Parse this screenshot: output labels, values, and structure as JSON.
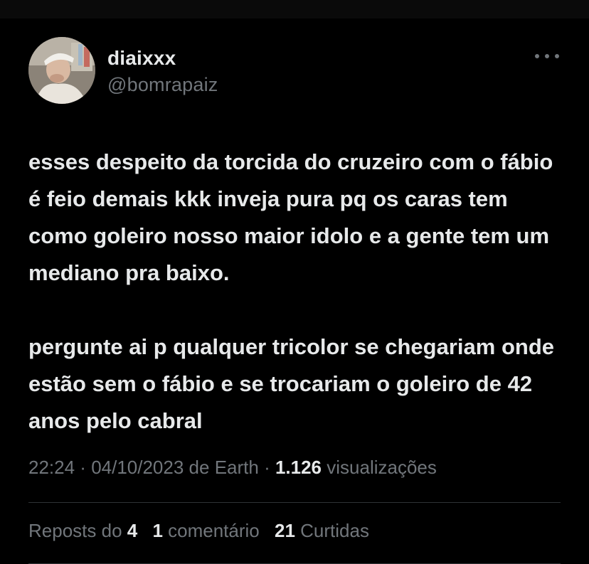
{
  "author": {
    "display_name": "diaixxx",
    "handle": "@bomrapaiz"
  },
  "tweet": {
    "paragraphs": [
      "esses despeito da torcida do cruzeiro com o fábio é feio demais kkk inveja pura pq os caras tem como goleiro nosso maior idolo e a gente tem um mediano pra baixo.",
      "pergunte ai p qualquer tricolor se chegariam onde estão sem o fábio e se trocariam o goleiro de 42 anos pelo cabral"
    ]
  },
  "meta": {
    "time": "22:24",
    "separator": " · ",
    "date": "04/10/2023",
    "source": " de Earth",
    "views_count": "1.126",
    "views_label": " visualizações"
  },
  "stats": {
    "reposts_label": "Reposts do ",
    "reposts_count": "4",
    "comments_count": "1",
    "comments_label": " comentário",
    "likes_count": "21",
    "likes_label": " Curtidas"
  },
  "icons": {
    "more": "more-options-icon"
  }
}
